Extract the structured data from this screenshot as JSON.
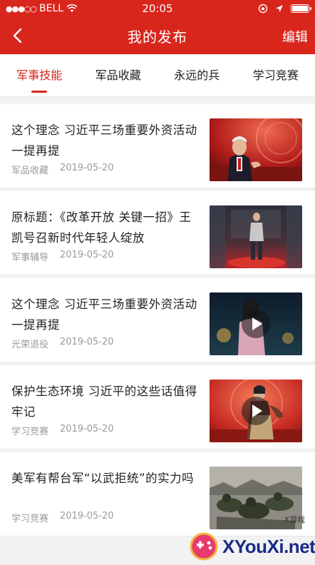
{
  "status_bar": {
    "carrier": "BELL",
    "time": "20:05"
  },
  "header": {
    "title": "我的发布",
    "edit_label": "编辑"
  },
  "tabs": [
    {
      "label": "军事技能",
      "active": true
    },
    {
      "label": "军品收藏",
      "active": false
    },
    {
      "label": "永远的兵",
      "active": false
    },
    {
      "label": "学习竞赛",
      "active": false
    }
  ],
  "items": [
    {
      "title": "这个理念 习近平三场重要外资活动一提再提",
      "category": "军品收藏",
      "date": "2019-05-20",
      "video": false
    },
    {
      "title": "原标题：《改革开放 关键一招》王凯号召新时代年轻人绽放",
      "category": "军事辅导",
      "date": "2019-05-20",
      "video": false
    },
    {
      "title": "这个理念 习近平三场重要外资活动一提再提",
      "category": "光荣退役",
      "date": "2019-05-20",
      "video": true
    },
    {
      "title": "保护生态环境 习近平的这些话值得牢记",
      "category": "学习竞赛",
      "date": "2019-05-20",
      "video": true
    },
    {
      "title": "美军有帮台军“以武拒统”的实力吗",
      "category": "学习竞赛",
      "date": "2019-05-20",
      "video": false
    }
  ],
  "watermark": {
    "top_text": "X游戏",
    "main_text": "XYouXi.net"
  },
  "colors": {
    "brand_red": "#d9261c"
  }
}
